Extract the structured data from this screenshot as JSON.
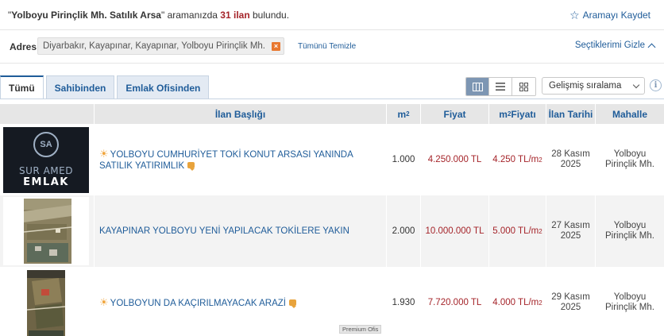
{
  "summary": {
    "query": "Yolboyu Pirinçlik Mh. Satılık Arsa",
    "middle": "aramanızda",
    "count": "31 ilan",
    "tail": "bulundu.",
    "save_search": "Aramayı Kaydet"
  },
  "filters": {
    "address_label": "Adres",
    "address_value": "Diyarbakır, Kayapınar, Kayapınar, Yolboyu Pirinçlik Mh.",
    "clear_all": "Tümünü Temizle",
    "hide_selections": "Seçtiklerimi Gizle"
  },
  "tabs": [
    {
      "label": "Tümü",
      "active": true
    },
    {
      "label": "Sahibinden",
      "active": false
    },
    {
      "label": "Emlak Ofisinden",
      "active": false
    }
  ],
  "sort": {
    "selected": "Gelişmiş sıralama"
  },
  "columns": {
    "title": "İlan Başlığı",
    "m2": "m",
    "price": "Fiyat",
    "m2_price": "m",
    "m2_price_tail": " Fiyatı",
    "date": "İlan Tarihi",
    "area": "Mahalle"
  },
  "listings": [
    {
      "title": "YOLBOYU CUMHURİYET TOKİ KONUT ARSASI YANINDA SATILIK YATIRIMLIK",
      "m2": "1.000",
      "price": "4.250.000 TL",
      "m2_price": "4.250 TL/m",
      "date_day": "28 Kasım",
      "date_year": "2025",
      "area_1": "Yolboyu",
      "area_2": "Pirinçlik Mh.",
      "thumb": "logo",
      "logo_line1": "SUR AMED",
      "logo_line2": "EMLAK"
    },
    {
      "title": "KAYAPINAR YOLBOYU YENİ YAPILACAK TOKİLERE YAKIN",
      "m2": "2.000",
      "price": "10.000.000 TL",
      "m2_price": "5.000 TL/m",
      "date_day": "27 Kasım",
      "date_year": "2025",
      "area_1": "Yolboyu",
      "area_2": "Pirinçlik Mh.",
      "thumb": "aerial"
    },
    {
      "title": "YOLBOYUN DA KAÇIRILMAYACAK ARAZİ",
      "m2": "1.930",
      "price": "7.720.000 TL",
      "m2_price": "4.000 TL/m",
      "date_day": "29 Kasım",
      "date_year": "2025",
      "area_1": "Yolboyu",
      "area_2": "Pirinçlik Mh.",
      "thumb": "aerial",
      "badge": "Premium Ofis"
    }
  ],
  "superscript": "2",
  "colors": {
    "link": "#1f5c99",
    "price": "#a5242a",
    "accent_orange": "#e8772e",
    "header_bg": "#e6e6e6",
    "row_alt": "#f3f3f3"
  }
}
